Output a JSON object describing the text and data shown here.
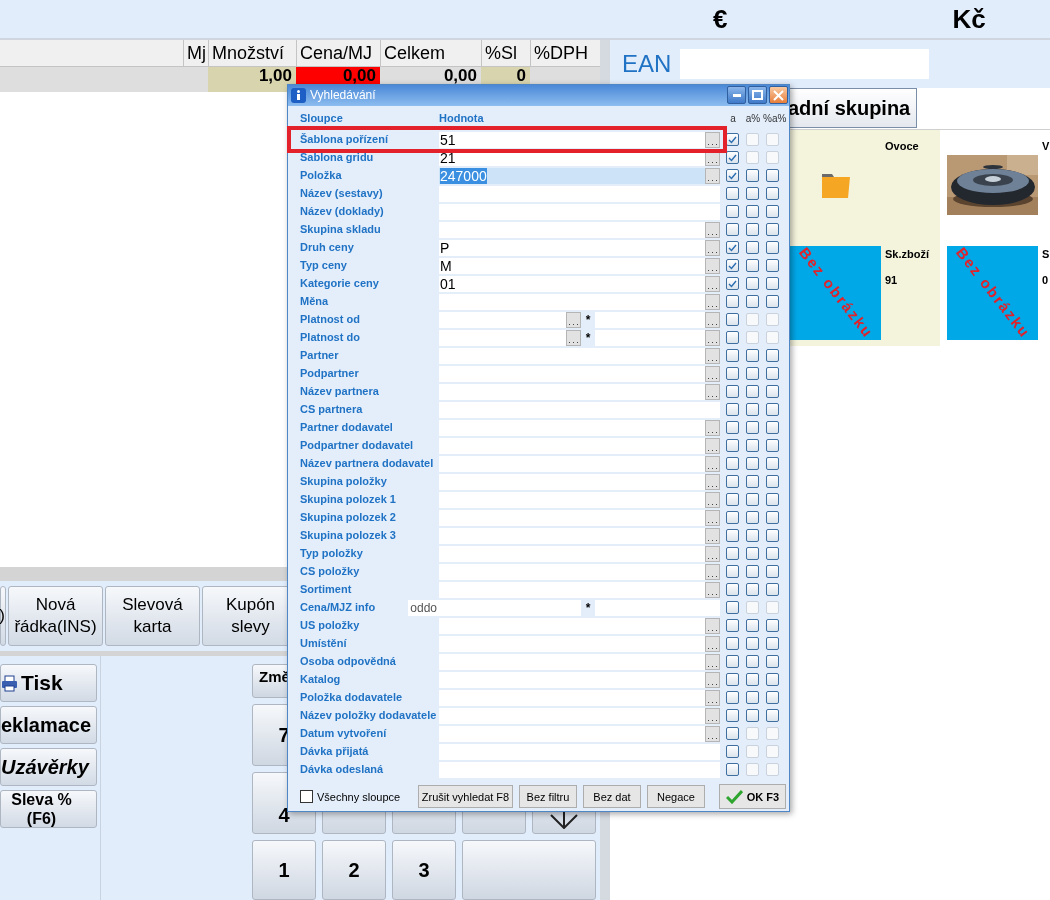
{
  "top_bar": {
    "currencies": [
      "€",
      "Kč"
    ]
  },
  "table": {
    "columns": [
      "Mj",
      "Množství",
      "Cena/MJ",
      "Celkem",
      "%Sl",
      "%DPH"
    ],
    "row": {
      "quantity": {
        "text": "1,00",
        "color": "#d8d5ae"
      },
      "unit_price": {
        "text": "0,00",
        "color": "#ff0000"
      },
      "total": {
        "text": "0,00"
      },
      "discount": {
        "text": "0",
        "color": "#d8d5ae"
      }
    }
  },
  "actions": [
    ")",
    "Nová řádka(INS)",
    "Slevová karta",
    "Kupón slevy"
  ],
  "side_buttons": [
    {
      "label": "Tisk",
      "kind": "print"
    },
    {
      "label": "eklamace",
      "kind": "plain"
    },
    {
      "label": "Uzávěrky",
      "kind": "italic"
    },
    {
      "label": "Sleva % (F6)",
      "kind": "small"
    }
  ],
  "keypad": [
    [
      {
        "kind": "label",
        "label": "Změ"
      }
    ],
    [
      {
        "kind": "digit",
        "label": "7"
      }
    ],
    [
      {
        "kind": "digit",
        "label": "4"
      },
      {
        "kind": "blank"
      },
      {
        "kind": "blank"
      },
      {
        "kind": "blank"
      },
      {
        "kind": "down"
      }
    ],
    [
      {
        "kind": "digit",
        "label": "1"
      },
      {
        "kind": "digit",
        "label": "2"
      },
      {
        "kind": "digit",
        "label": "3"
      },
      {
        "kind": "wide"
      }
    ]
  ],
  "ean": {
    "label": "EAN"
  },
  "group_button": "adní skupina",
  "tiles": [
    {
      "kind": "folder",
      "name": "Ovoce",
      "selected": true
    },
    {
      "name": "V",
      "selected": false
    },
    {
      "kind": "placeholder",
      "placeholder": "Bez obrázku",
      "name": "Sk.zboží",
      "code": "91",
      "selected": true
    },
    {
      "kind": "placeholder",
      "placeholder": "Bez obrázku",
      "name": "S",
      "code": "0",
      "selected": false
    }
  ],
  "dialog": {
    "title": "Vyhledávání",
    "columns": [
      "Sloupce",
      "Hodnota",
      "a",
      "a%",
      "%a%"
    ],
    "rows": [
      {
        "label": "Šablona pořízení",
        "kind": "lookup",
        "value": "51",
        "a": true,
        "pct_disabled": true,
        "selected": false,
        "marked": true
      },
      {
        "label": "Šablona gridu",
        "kind": "lookup",
        "value": "21",
        "a": true,
        "pct_disabled": true,
        "selected": false,
        "marked": false
      },
      {
        "label": "Položka",
        "kind": "lookup",
        "value": "247000",
        "a": true,
        "pct_disabled": false,
        "selected": true,
        "marked": false
      },
      {
        "label": "Název (sestavy)",
        "kind": "text",
        "a": false,
        "pct_disabled": false,
        "selected": false,
        "marked": false
      },
      {
        "label": "Název (doklady)",
        "kind": "text",
        "a": false,
        "pct_disabled": false,
        "selected": false,
        "marked": false
      },
      {
        "label": "Skupina skladu",
        "kind": "lookup",
        "a": false,
        "pct_disabled": false,
        "selected": false,
        "marked": false
      },
      {
        "label": "Druh ceny",
        "kind": "lookup",
        "value": "P",
        "a": true,
        "pct_disabled": false,
        "selected": false,
        "marked": false
      },
      {
        "label": "Typ ceny",
        "kind": "lookup",
        "value": "M",
        "a": true,
        "pct_disabled": false,
        "selected": false,
        "marked": false
      },
      {
        "label": "Kategorie ceny",
        "kind": "lookup",
        "value": "01",
        "a": true,
        "pct_disabled": false,
        "selected": false,
        "marked": false
      },
      {
        "label": "Měna",
        "kind": "lookup",
        "a": false,
        "pct_disabled": false,
        "selected": false,
        "marked": false
      },
      {
        "label": "Platnost od",
        "kind": "range",
        "separator": "*",
        "a": false,
        "pct_disabled": true,
        "selected": false,
        "marked": false
      },
      {
        "label": "Platnost do",
        "kind": "range",
        "separator": "*",
        "a": false,
        "pct_disabled": true,
        "selected": false,
        "marked": false
      },
      {
        "label": "Partner",
        "kind": "lookup",
        "a": false,
        "pct_disabled": false,
        "selected": false,
        "marked": false
      },
      {
        "label": "Podpartner",
        "kind": "lookup",
        "a": false,
        "pct_disabled": false,
        "selected": false,
        "marked": false
      },
      {
        "label": "Název partnera",
        "kind": "lookup",
        "a": false,
        "pct_disabled": false,
        "selected": false,
        "marked": false
      },
      {
        "label": "CS partnera",
        "kind": "text",
        "a": false,
        "pct_disabled": false,
        "selected": false,
        "marked": false
      },
      {
        "label": "Partner dodavatel",
        "kind": "lookup",
        "a": false,
        "pct_disabled": false,
        "selected": false,
        "marked": false
      },
      {
        "label": "Podpartner dodavatel",
        "kind": "lookup",
        "a": false,
        "pct_disabled": false,
        "selected": false,
        "marked": false
      },
      {
        "label": "Název partnera dodavatel",
        "kind": "lookup",
        "a": false,
        "pct_disabled": false,
        "selected": false,
        "marked": false
      },
      {
        "label": "Skupina položky",
        "kind": "lookup",
        "a": false,
        "pct_disabled": false,
        "selected": false,
        "marked": false
      },
      {
        "label": "Skupina polozek 1",
        "kind": "lookup",
        "a": false,
        "pct_disabled": false,
        "selected": false,
        "marked": false
      },
      {
        "label": "Skupina polozek 2",
        "kind": "lookup",
        "a": false,
        "pct_disabled": false,
        "selected": false,
        "marked": false
      },
      {
        "label": "Skupina polozek 3",
        "kind": "lookup",
        "a": false,
        "pct_disabled": false,
        "selected": false,
        "marked": false
      },
      {
        "label": "Typ položky",
        "kind": "lookup",
        "a": false,
        "pct_disabled": false,
        "selected": false,
        "marked": false
      },
      {
        "label": "CS položky",
        "kind": "lookup",
        "a": false,
        "pct_disabled": false,
        "selected": false,
        "marked": false
      },
      {
        "label": "Sortiment",
        "kind": "lookup",
        "a": false,
        "pct_disabled": false,
        "selected": false,
        "marked": false
      },
      {
        "label": "Cena/MJZ info",
        "kind": "range_text",
        "prefix": "oddo",
        "separator": "*",
        "a": false,
        "pct_disabled": true,
        "selected": false,
        "marked": false
      },
      {
        "label": "US položky",
        "kind": "lookup",
        "a": false,
        "pct_disabled": false,
        "selected": false,
        "marked": false
      },
      {
        "label": "Umístění",
        "kind": "lookup",
        "a": false,
        "pct_disabled": false,
        "selected": false,
        "marked": false
      },
      {
        "label": "Osoba odpovědná",
        "kind": "lookup",
        "a": false,
        "pct_disabled": false,
        "selected": false,
        "marked": false
      },
      {
        "label": "Katalog",
        "kind": "lookup",
        "a": false,
        "pct_disabled": false,
        "selected": false,
        "marked": false
      },
      {
        "label": "Položka dodavatele",
        "kind": "lookup",
        "a": false,
        "pct_disabled": false,
        "selected": false,
        "marked": false
      },
      {
        "label": "Název položky dodavatele",
        "kind": "lookup",
        "a": false,
        "pct_disabled": false,
        "selected": false,
        "marked": false
      },
      {
        "label": "Datum vytvoření",
        "kind": "lookup",
        "a": false,
        "pct_disabled": true,
        "selected": false,
        "marked": false
      },
      {
        "label": "Dávka přijatá",
        "kind": "text",
        "a": false,
        "pct_disabled": true,
        "selected": false,
        "marked": false
      },
      {
        "label": "Dávka odeslaná",
        "kind": "text",
        "a": false,
        "pct_disabled": true,
        "selected": false,
        "marked": false
      }
    ],
    "all_columns": {
      "label": "Všechny sloupce",
      "checked": false
    },
    "buttons": [
      "Zrušit vyhledat F8",
      "Bez filtru",
      "Bez dat",
      "Negace"
    ],
    "ok_button": "OK F3"
  }
}
